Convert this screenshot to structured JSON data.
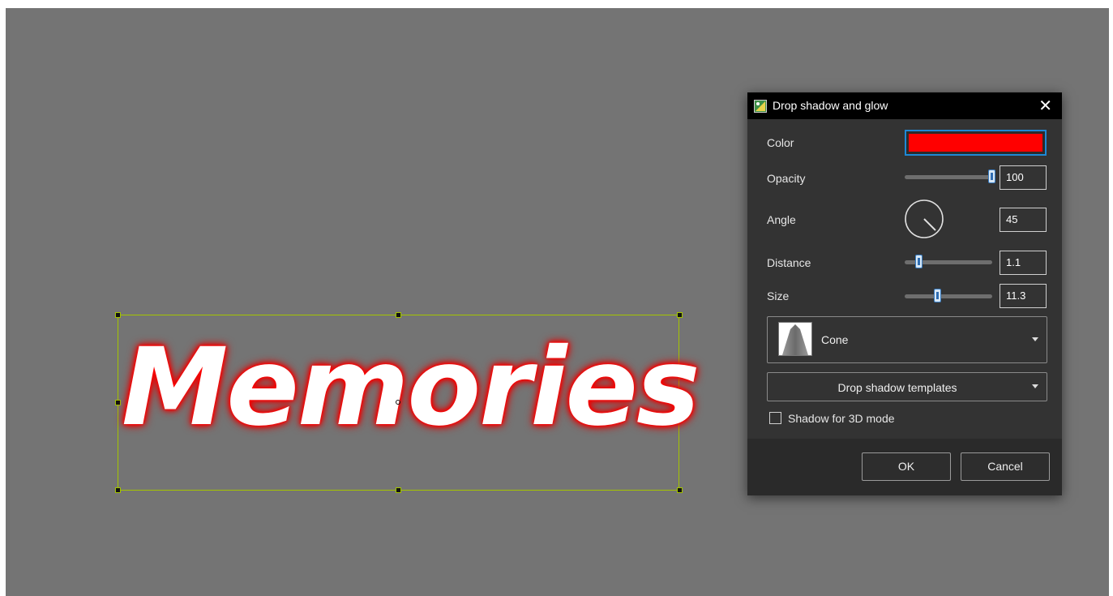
{
  "canvas": {
    "text_object": "Memories"
  },
  "dialog": {
    "title": "Drop shadow and glow",
    "close_glyph": "✕",
    "color": {
      "label": "Color",
      "value_hex": "#ff0000"
    },
    "opacity": {
      "label": "Opacity",
      "value": "100",
      "slider_fraction": 1.0
    },
    "angle": {
      "label": "Angle",
      "value": "45"
    },
    "distance": {
      "label": "Distance",
      "value": "1.1",
      "slider_fraction": 0.17
    },
    "size": {
      "label": "Size",
      "value": "11.3",
      "slider_fraction": 0.38
    },
    "shape": {
      "selected": "Cone",
      "icon": "cone-shape-icon"
    },
    "templates": {
      "label": "Drop shadow templates"
    },
    "shadow_3d": {
      "label": "Shadow for 3D mode",
      "checked": false
    },
    "buttons": {
      "ok": "OK",
      "cancel": "Cancel"
    }
  },
  "colors": {
    "canvas_bg": "#747474",
    "dialog_bg": "#333333",
    "glow": "#ff0000",
    "selection": "#a4c400",
    "focus": "#1e88d6"
  }
}
